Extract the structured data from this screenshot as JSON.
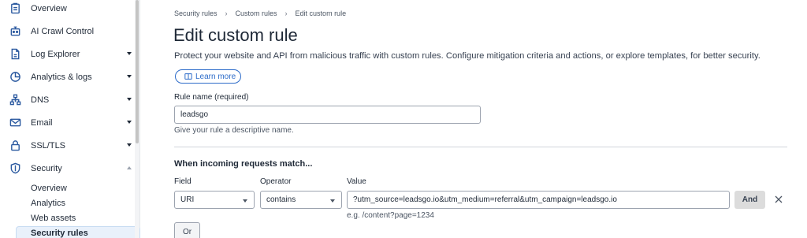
{
  "sidebar": {
    "items": [
      {
        "label": "Overview",
        "icon": "clipboard-icon",
        "caret": "none"
      },
      {
        "label": "AI Crawl Control",
        "icon": "robot-icon",
        "caret": "none"
      },
      {
        "label": "Log Explorer",
        "icon": "document-icon",
        "caret": "down"
      },
      {
        "label": "Analytics & logs",
        "icon": "chart-pie-icon",
        "caret": "down"
      },
      {
        "label": "DNS",
        "icon": "network-icon",
        "caret": "down"
      },
      {
        "label": "Email",
        "icon": "email-icon",
        "caret": "down"
      },
      {
        "label": "SSL/TLS",
        "icon": "lock-icon",
        "caret": "down"
      },
      {
        "label": "Security",
        "icon": "shield-icon",
        "caret": "up"
      }
    ],
    "security_sub_items": [
      "Overview",
      "Analytics",
      "Web assets"
    ],
    "active_sub_item": "Security rules"
  },
  "breadcrumb": [
    "Security rules",
    "Custom rules",
    "Edit custom rule"
  ],
  "page": {
    "title": "Edit custom rule",
    "description": "Protect your website and API from malicious traffic with custom rules. Configure mitigation criteria and actions, or explore templates, for better security.",
    "learn_more": "Learn more"
  },
  "rule_name": {
    "label": "Rule name (required)",
    "value": "leadsgo",
    "help": "Give your rule a descriptive name."
  },
  "match": {
    "title": "When incoming requests match...",
    "field_label": "Field",
    "operator_label": "Operator",
    "value_label": "Value",
    "field_value": "URI",
    "operator_value": "contains",
    "value_value": "?utm_source=leadsgo.io&utm_medium=referral&utm_campaign=leadsgo.io",
    "value_example": "e.g. /content?page=1234",
    "and_label": "And",
    "or_label": "Or"
  },
  "colors": {
    "accent": "#2c6bc9",
    "icon": "#2c5aa0",
    "active_bg": "#e9f1fb"
  }
}
